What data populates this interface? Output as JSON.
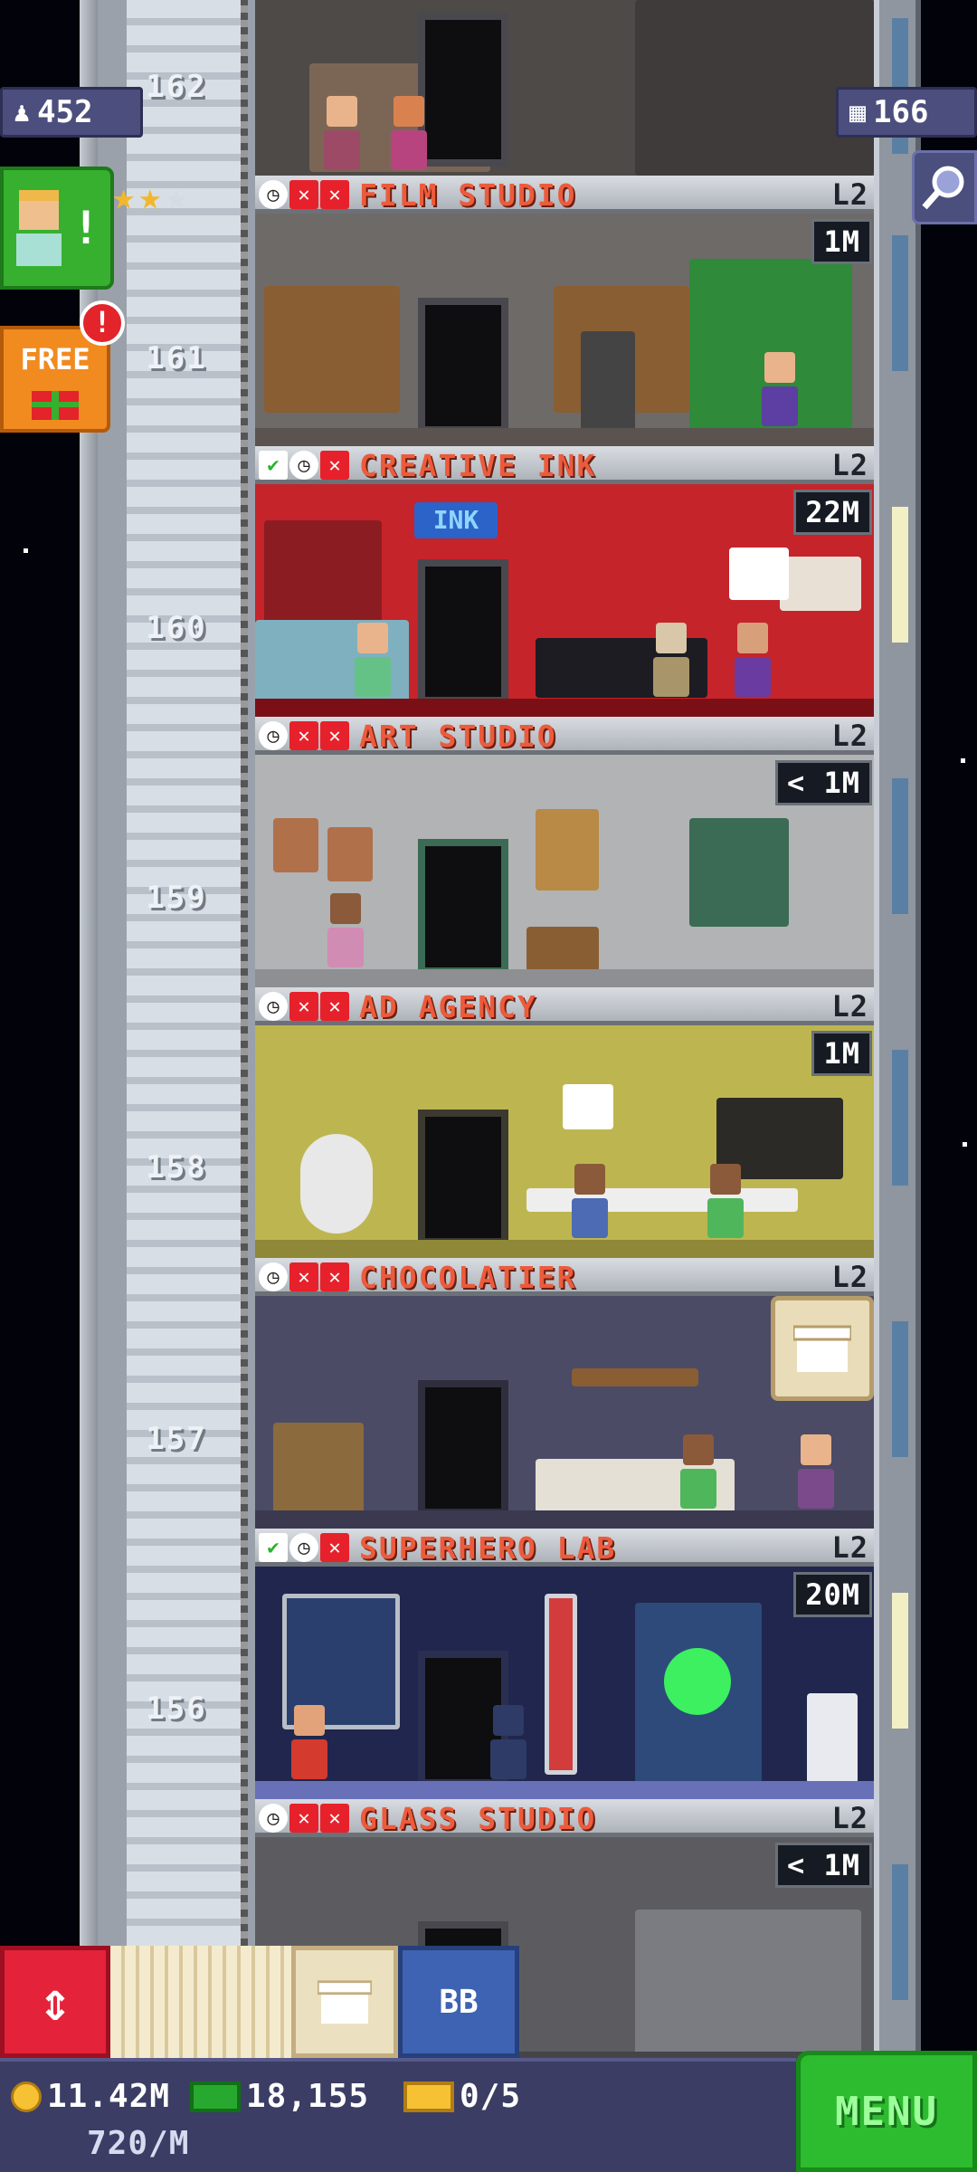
{
  "hud": {
    "population": "452",
    "floors_count": "166"
  },
  "shaft_floors": [
    "162",
    "161",
    "160",
    "159",
    "158",
    "157",
    "156"
  ],
  "floors": [
    {
      "name": "FILM STUDIO",
      "level": "L2",
      "earn": "1M",
      "check": false
    },
    {
      "name": "CREATIVE INK",
      "level": "L2",
      "earn": "22M",
      "check": true
    },
    {
      "name": "ART STUDIO",
      "level": "L2",
      "earn": "< 1M",
      "check": false
    },
    {
      "name": "AD AGENCY",
      "level": "L2",
      "earn": "1M",
      "check": false
    },
    {
      "name": "CHOCOLATIER",
      "level": "L2",
      "earn": "",
      "check": false
    },
    {
      "name": "SUPERHERO LAB",
      "level": "L2",
      "earn": "20M",
      "check": true
    },
    {
      "name": "GLASS STUDIO",
      "level": "L2",
      "earn": "< 1M",
      "check": false
    }
  ],
  "room_signs": {
    "ink": "INK"
  },
  "free_button": {
    "label": "FREE",
    "badge": "!"
  },
  "vip_alert": "!",
  "toolbar": {
    "bb_label": "BB"
  },
  "status": {
    "coins": "11.42M",
    "coin_rate": "720/M",
    "bux": "18,155",
    "tickets": "0/5"
  },
  "menu_label": "MENU",
  "colors": {
    "banner_text": "#ec5b3c",
    "menu_green": "#2dbb2f",
    "elevator_red": "#e4223a",
    "status_bar": "#3b3d64"
  }
}
